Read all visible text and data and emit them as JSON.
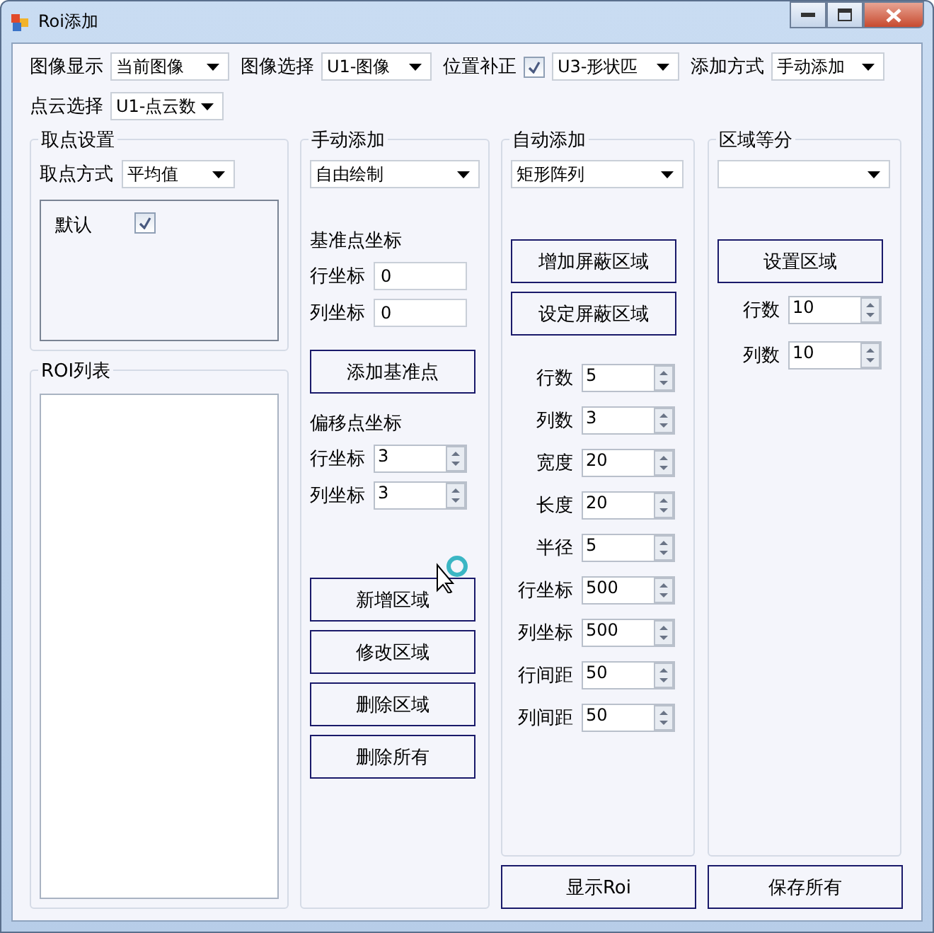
{
  "window": {
    "title": "Roi添加"
  },
  "top_fields": [
    {
      "kind": "combo",
      "label": "图像显示",
      "value": "当前图像"
    },
    {
      "kind": "combo",
      "label": "图像选择",
      "value": "U1-图像"
    },
    {
      "kind": "checkcombo",
      "label": "位置补正",
      "checked": true,
      "value": "U3-形状匹"
    },
    {
      "kind": "combo",
      "label": "添加方式",
      "value": "手动添加"
    },
    {
      "kind": "combo",
      "label": "点云选择",
      "value": "U1-点云数"
    }
  ],
  "pick_settings": {
    "title": "取点设置",
    "method_label": "取点方式",
    "method_value": "平均值",
    "default_label": "默认",
    "default_checked": true
  },
  "roi_list": {
    "title": "ROI列表"
  },
  "manual": {
    "title": "手动添加",
    "mode": "自由绘制",
    "base_title": "基准点坐标",
    "base_fields": [
      {
        "label": "行坐标",
        "value": "0"
      },
      {
        "label": "列坐标",
        "value": "0"
      }
    ],
    "add_base_button": "添加基准点",
    "offset_title": "偏移点坐标",
    "offset_fields": [
      {
        "label": "行坐标",
        "value": "3"
      },
      {
        "label": "列坐标",
        "value": "3"
      }
    ],
    "buttons": [
      "新增区域",
      "修改区域",
      "删除区域",
      "删除所有"
    ]
  },
  "auto": {
    "title": "自动添加",
    "mode": "矩形阵列",
    "buttons": [
      "增加屏蔽区域",
      "设定屏蔽区域"
    ],
    "params": [
      {
        "label": "行数",
        "value": "5"
      },
      {
        "label": "列数",
        "value": "3"
      },
      {
        "label": "宽度",
        "value": "20"
      },
      {
        "label": "长度",
        "value": "20"
      },
      {
        "label": "半径",
        "value": "5"
      },
      {
        "label": "行坐标",
        "value": "500"
      },
      {
        "label": "列坐标",
        "value": "500"
      },
      {
        "label": "行间距",
        "value": "50"
      },
      {
        "label": "列间距",
        "value": "50"
      }
    ]
  },
  "divide": {
    "title": "区域等分",
    "button": "设置区域",
    "params": [
      {
        "label": "行数",
        "value": "10"
      },
      {
        "label": "列数",
        "value": "10"
      }
    ]
  },
  "bottom_buttons": [
    "显示Roi",
    "保存所有"
  ]
}
